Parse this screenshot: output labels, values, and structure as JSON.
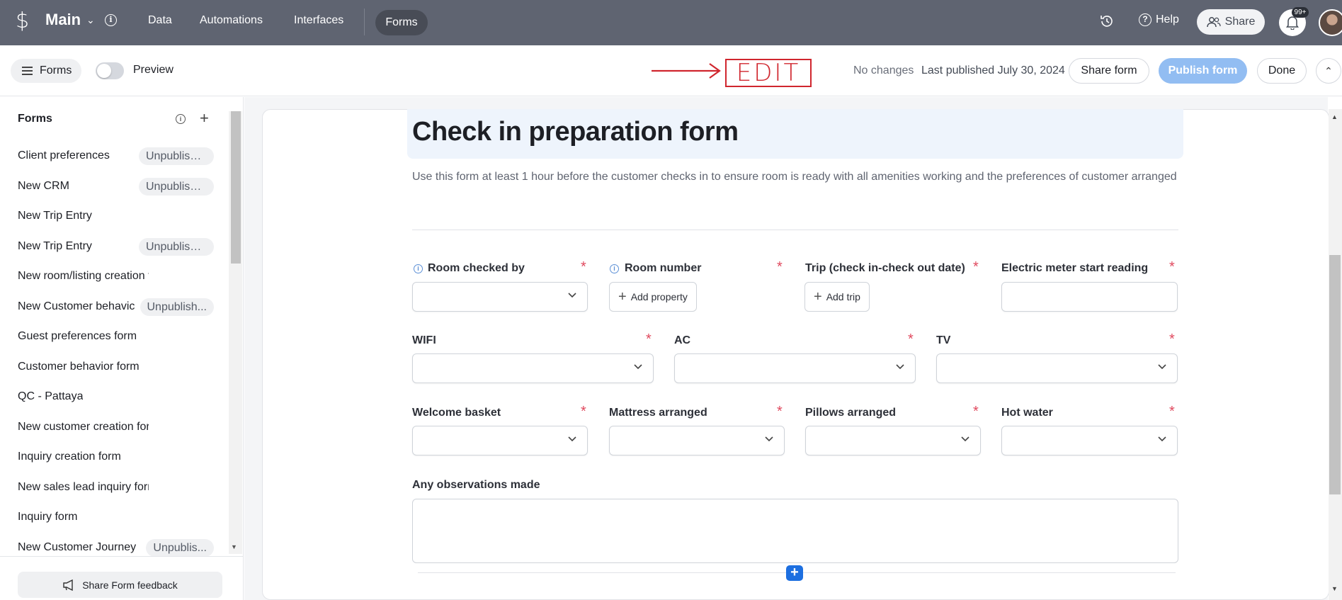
{
  "topbar": {
    "base_name": "Main",
    "nav": [
      "Data",
      "Automations",
      "Interfaces"
    ],
    "active_nav": "Forms",
    "help_label": "Help",
    "share_label": "Share",
    "notification_count": "99+"
  },
  "toolbar": {
    "forms_label": "Forms",
    "preview_label": "Preview",
    "annotation": "EDIT",
    "status": "No changes",
    "last_published": "Last published July 30, 2024",
    "share_form_label": "Share form",
    "publish_label": "Publish form",
    "done_label": "Done"
  },
  "sidebar": {
    "title": "Forms",
    "items": [
      {
        "label": "Client preferences",
        "badge": "Unpublished"
      },
      {
        "label": "New CRM",
        "badge": "Unpublished"
      },
      {
        "label": "New Trip Entry",
        "badge": ""
      },
      {
        "label": "New Trip Entry",
        "badge": "Unpublished"
      },
      {
        "label": "New room/listing creation form",
        "badge": ""
      },
      {
        "label": "New Customer behavic",
        "badge": "Unpublish..."
      },
      {
        "label": "Guest preferences form",
        "badge": ""
      },
      {
        "label": "Customer behavior form",
        "badge": ""
      },
      {
        "label": "QC - Pattaya",
        "badge": ""
      },
      {
        "label": "New customer creation form",
        "badge": ""
      },
      {
        "label": "Inquiry creation form",
        "badge": ""
      },
      {
        "label": "New sales lead inquiry form",
        "badge": ""
      },
      {
        "label": "Inquiry form",
        "badge": ""
      },
      {
        "label": "New Customer Journey",
        "badge": "Unpublis..."
      }
    ],
    "feedback_label": "Share Form feedback"
  },
  "form": {
    "title": "Check in preparation form",
    "description": "Use this form at least 1 hour before the customer checks in to ensure room is ready with all amenities working and the preferences of customer arranged",
    "fields": {
      "room_checked_by": "Room checked by",
      "room_number": "Room number",
      "add_property": "Add property",
      "trip": "Trip (check in-check out date)",
      "add_trip": "Add trip",
      "electric_meter": "Electric meter start reading",
      "wifi": "WIFI",
      "ac": "AC",
      "tv": "TV",
      "welcome_basket": "Welcome basket",
      "mattress": "Mattress arranged",
      "pillows": "Pillows arranged",
      "hot_water": "Hot water",
      "observations": "Any observations made"
    },
    "required_mark": "*"
  },
  "colors": {
    "topbar": "#5f6471",
    "publish_button": "#92bdf2",
    "annotation": "#d0262e",
    "required": "#e0495e",
    "add_button": "#1d6fe0"
  }
}
